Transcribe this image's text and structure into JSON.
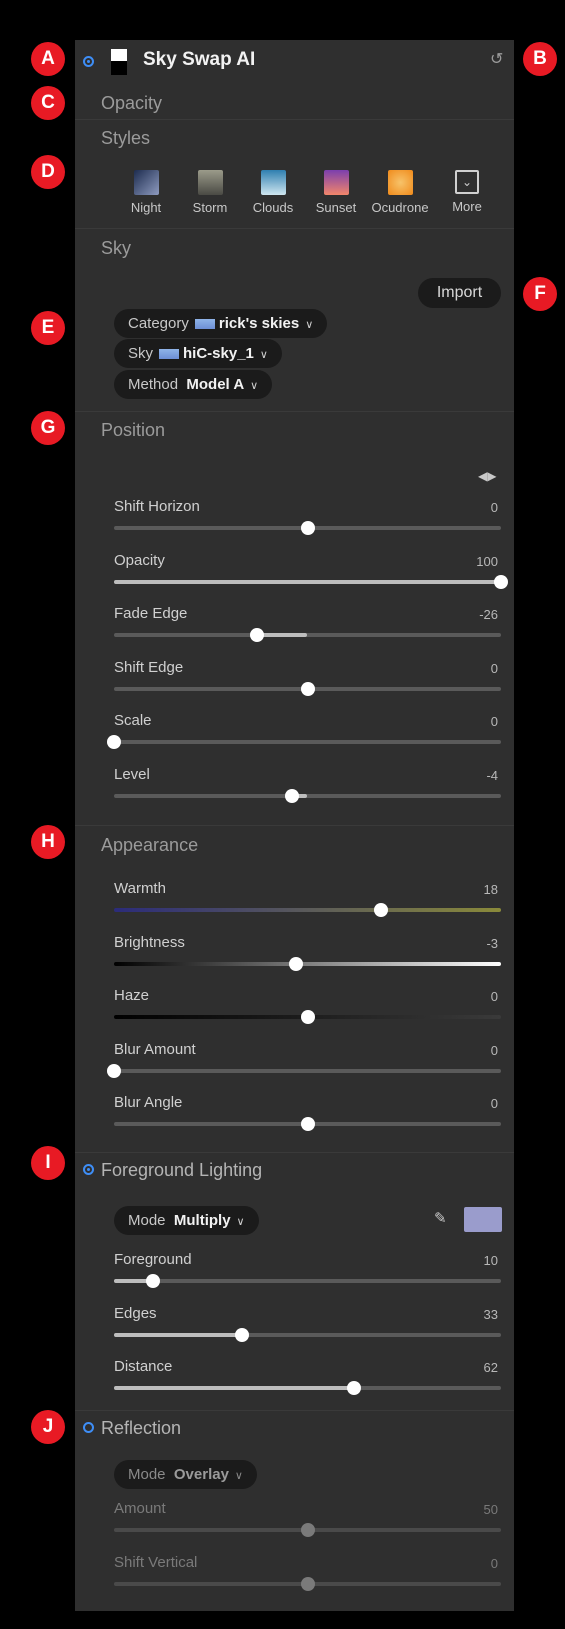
{
  "callouts": [
    "A",
    "B",
    "C",
    "D",
    "E",
    "F",
    "G",
    "H",
    "I",
    "J"
  ],
  "header": {
    "title": "Sky Swap AI",
    "mask_icon": "mask-icon",
    "reset_icon": "reset-icon",
    "enable_icon": "radio-on-icon"
  },
  "sections": {
    "opacity": "Opacity",
    "styles": "Styles",
    "sky": "Sky",
    "position": "Position",
    "appearance": "Appearance",
    "foreground_lighting": "Foreground Lighting",
    "reflection": "Reflection"
  },
  "styles": [
    {
      "label": "Night",
      "color_a": "#1d2c4f",
      "color_b": "#8e9bbf"
    },
    {
      "label": "Storm",
      "color_a": "#4a4a44",
      "color_b": "#9b9b8a"
    },
    {
      "label": "Clouds",
      "color_a": "#2f7fb0",
      "color_b": "#cfe6f0"
    },
    {
      "label": "Sunset",
      "color_a": "#7b3fae",
      "color_b": "#f2866a"
    },
    {
      "label": "Ocudrone",
      "color_a": "#f08a1a",
      "color_b": "#f7c36a"
    },
    {
      "label": "More",
      "color_a": "",
      "color_b": ""
    }
  ],
  "sky": {
    "import_label": "Import",
    "category_label": "Category",
    "category_value": "rick's skies",
    "sky_label": "Sky",
    "sky_value": "hiC-sky_1",
    "method_label": "Method",
    "method_value": "Model A"
  },
  "position": {
    "sliders": [
      {
        "label": "Shift Horizon",
        "value": "0",
        "fraction": 0.5
      },
      {
        "label": "Opacity",
        "value": "100",
        "fraction": 1.0
      },
      {
        "label": "Fade Edge",
        "value": "-26",
        "fraction": 0.37
      },
      {
        "label": "Shift Edge",
        "value": "0",
        "fraction": 0.5
      },
      {
        "label": "Scale",
        "value": "0",
        "fraction": 0.0
      },
      {
        "label": "Level",
        "value": "-4",
        "fraction": 0.46
      }
    ]
  },
  "appearance": {
    "sliders": [
      {
        "label": "Warmth",
        "value": "18",
        "fraction": 0.69
      },
      {
        "label": "Brightness",
        "value": "-3",
        "fraction": 0.47
      },
      {
        "label": "Haze",
        "value": "0",
        "fraction": 0.5
      },
      {
        "label": "Blur Amount",
        "value": "0",
        "fraction": 0.0
      },
      {
        "label": "Blur Angle",
        "value": "0",
        "fraction": 0.5
      }
    ]
  },
  "foreground": {
    "mode_label": "Mode",
    "mode_value": "Multiply",
    "swatch_color": "#9a9ccc",
    "sliders": [
      {
        "label": "Foreground",
        "value": "10",
        "fraction": 0.1
      },
      {
        "label": "Edges",
        "value": "33",
        "fraction": 0.33
      },
      {
        "label": "Distance",
        "value": "62",
        "fraction": 0.62
      }
    ]
  },
  "reflection": {
    "mode_label": "Mode",
    "mode_value": "Overlay",
    "sliders": [
      {
        "label": "Amount",
        "value": "50",
        "fraction": 0.5
      },
      {
        "label": "Shift Vertical",
        "value": "0",
        "fraction": 0.5
      }
    ]
  },
  "colors": {
    "accent": "#3e8ef7",
    "callout": "#e81a24",
    "panel": "#2f2f2f"
  }
}
